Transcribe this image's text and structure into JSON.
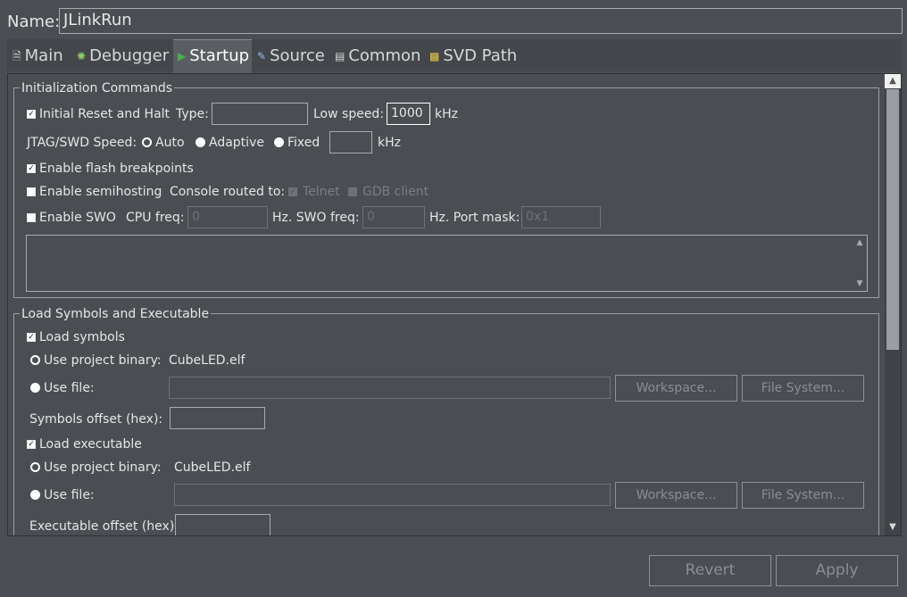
{
  "name": {
    "label": "Name:",
    "value": "JLinkRun"
  },
  "tabs": [
    {
      "label": "Main",
      "icon": "document-icon"
    },
    {
      "label": "Debugger",
      "icon": "bug-icon"
    },
    {
      "label": "Startup",
      "icon": "play-icon",
      "active": true
    },
    {
      "label": "Source",
      "icon": "source-icon"
    },
    {
      "label": "Common",
      "icon": "common-icon"
    },
    {
      "label": "SVD Path",
      "icon": "tree-icon"
    }
  ],
  "init": {
    "title": "Initialization Commands",
    "reset_label": "Initial Reset and Halt",
    "type_label": "Type:",
    "type_value": "",
    "low_speed_label": "Low speed:",
    "low_speed_value": "1000",
    "khz": "kHz",
    "jtag_label": "JTAG/SWD Speed:",
    "auto": "Auto",
    "adaptive": "Adaptive",
    "fixed": "Fixed",
    "fixed_value": "",
    "flash_bp": "Enable flash breakpoints",
    "semihosting": "Enable semihosting",
    "console_label": "Console routed to:",
    "telnet": "Telnet",
    "gdb_client": "GDB client",
    "swo": "Enable SWO",
    "cpu_freq_label": "CPU freq:",
    "cpu_freq_value": "0",
    "hz_swo_label": "Hz. SWO freq:",
    "swo_freq_value": "0",
    "port_mask_label": "Hz. Port mask:",
    "port_mask_value": "0x1"
  },
  "load": {
    "title": "Load Symbols and Executable",
    "load_symbols": "Load symbols",
    "use_project_binary": "Use project binary:",
    "binary_name": "CubeLED.elf",
    "use_file": "Use file:",
    "workspace": "Workspace...",
    "file_system": "File System...",
    "symbols_offset": "Symbols offset (hex):",
    "load_executable": "Load executable",
    "executable_offset": "Executable offset (hex):"
  },
  "buttons": {
    "revert": "Revert",
    "apply": "Apply"
  }
}
